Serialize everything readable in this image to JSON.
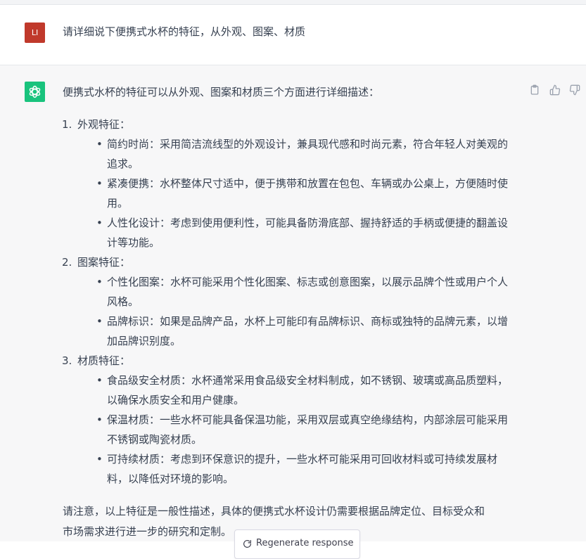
{
  "user": {
    "avatar": "LI",
    "avatar_color": "#c0392b",
    "message": "请详细说下便携式水杯的特征，从外观、图案、材质"
  },
  "assistant": {
    "avatar_icon": "openai-logo-icon",
    "avatar_color": "#19c37d",
    "intro": "便携式水杯的特征可以从外观、图案和材质三个方面进行详细描述：",
    "sections": [
      {
        "number": "1.",
        "title": "外观特征：",
        "bullets": [
          {
            "line1": "简约时尚：采用简洁流线型的外观设计，兼具现代感和时尚元素，符合年轻人对美观的",
            "line2": "追求。"
          },
          {
            "line1": "紧凑便携：水杯整体尺寸适中，便于携带和放置在包包、车辆或办公桌上，方便随时使",
            "line2": "用。"
          },
          {
            "line1": "人性化设计：考虑到使用便利性，可能具备防滑底部、握持舒适的手柄或便捷的翻盖设",
            "line2": "计等功能。"
          }
        ]
      },
      {
        "number": "2.",
        "title": "图案特征：",
        "bullets": [
          {
            "line1": "个性化图案：水杯可能采用个性化图案、标志或创意图案，以展示品牌个性或用户个人",
            "line2": "风格。"
          },
          {
            "line1": "品牌标识：如果是品牌产品，水杯上可能印有品牌标识、商标或独特的品牌元素，以增",
            "line2": "加品牌识别度。"
          }
        ]
      },
      {
        "number": "3.",
        "title": "材质特征：",
        "bullets": [
          {
            "line1": "食品级安全材质：水杯通常采用食品级安全材料制成，如不锈钢、玻璃或高品质塑料，",
            "line2": "以确保水质安全和用户健康。"
          },
          {
            "line1": "保温材质：一些水杯可能具备保温功能，采用双层或真空绝缘结构，内部涂层可能采用",
            "line2": "不锈钢或陶瓷材质。"
          },
          {
            "line1": "可持续材质：考虑到环保意识的提升，一些水杯可能采用可回收材料或可持续发展材",
            "line2": "料，以降低对环境的影响。"
          }
        ]
      }
    ],
    "closing_line1": "请注意，以上特征是一般性描述，具体的便携式水杯设计仍需要根据品牌定位、目标受众和",
    "closing_line2": "市场需求进行进一步的研究和定制。"
  },
  "actions": {
    "copy_icon": "clipboard-icon",
    "like_icon": "thumbs-up-icon",
    "dislike_icon": "thumbs-down-icon"
  },
  "regenerate": {
    "icon": "refresh-icon",
    "label": "Regenerate response"
  },
  "colors": {
    "assistant_background": "#f7f7f8",
    "text": "#374151"
  }
}
